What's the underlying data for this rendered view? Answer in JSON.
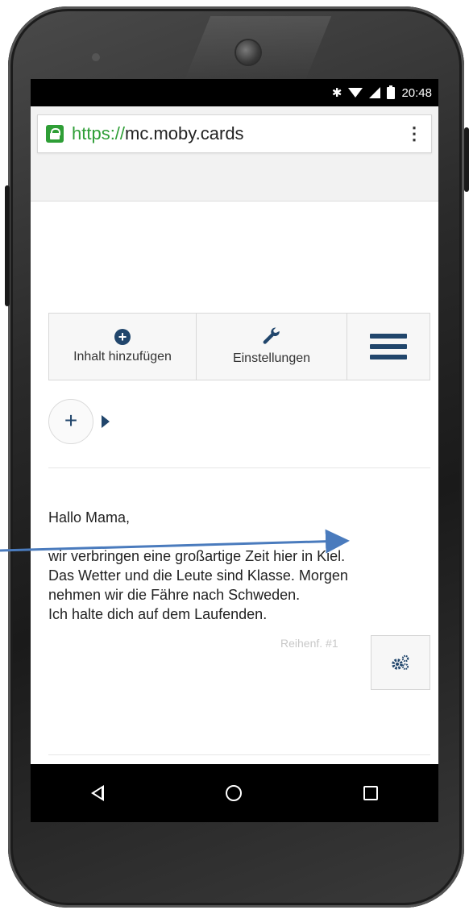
{
  "statusbar": {
    "bluetooth_icon": "bluetooth-icon",
    "time": "20:48"
  },
  "browser": {
    "url_scheme": "https://",
    "url_host": "mc.moby.cards",
    "menu_icon": "kebab-menu-icon"
  },
  "toolbar": {
    "add_label": "Inhalt hinzufügen",
    "settings_label": "Einstellungen",
    "add_icon": "plus-circle-icon",
    "settings_icon": "wrench-icon",
    "menu_icon": "hamburger-icon"
  },
  "add_pill": {
    "symbol": "+"
  },
  "content": {
    "greeting": "Hallo Mama,",
    "lines": [
      "wir verbringen eine großartige Zeit hier in Kiel.",
      "Das Wetter und die Leute sind Klasse. Morgen",
      "nehmen wir die Fähre nach Schweden.",
      "Ich halte dich auf dem Laufenden."
    ],
    "order_label": "Reihenf. #1",
    "gear_icon": "gears-icon"
  },
  "navbar": {
    "back_icon": "back-triangle-icon",
    "home_icon": "home-circle-icon",
    "recent_icon": "recent-apps-icon"
  },
  "colors": {
    "accent": "#21466c",
    "secure": "#2e9e36",
    "annotation_arrow": "#4a7bbd"
  }
}
